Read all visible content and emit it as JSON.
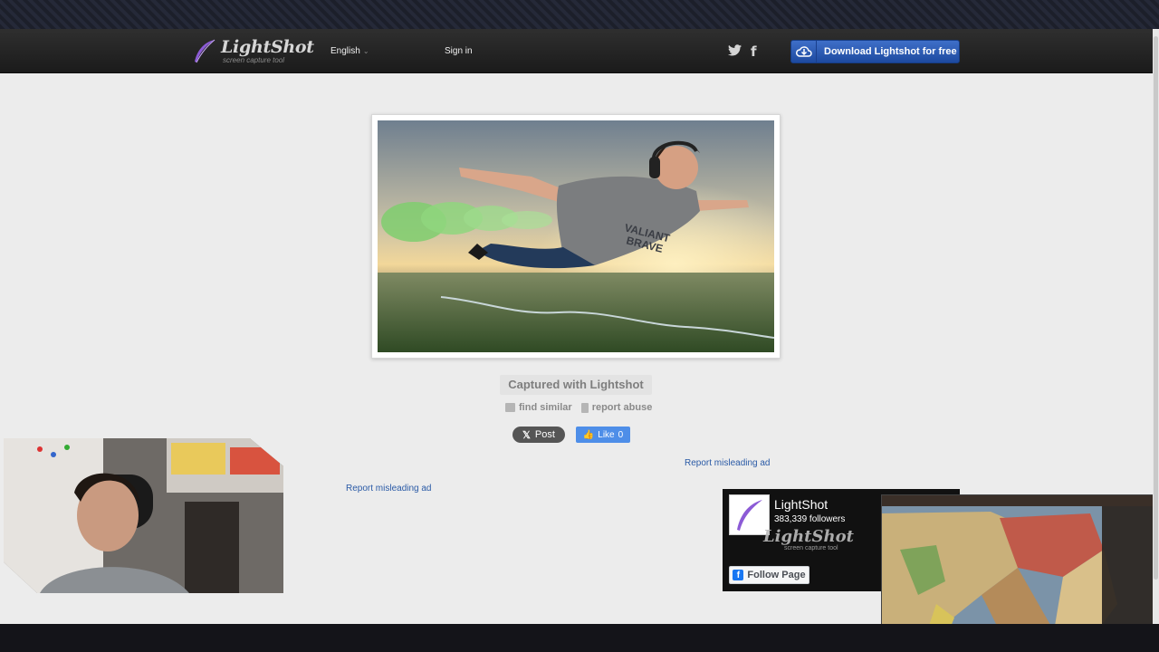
{
  "header": {
    "logo_name": "LightShot",
    "logo_tagline": "screen capture tool",
    "language": "English",
    "sign_in": "Sign in",
    "download_label": "Download Lightshot for free"
  },
  "main": {
    "captured_label": "Captured with Lightshot",
    "find_similar": "find similar",
    "report_abuse": "report abuse",
    "post_label": "Post",
    "like_label": "Like",
    "like_count": "0",
    "report_ad_1": "Report misleading ad",
    "report_ad_2": "Report misleading ad"
  },
  "fb_widget": {
    "page_name": "LightShot",
    "followers": "383,339 followers",
    "logo_mark": "LightShot",
    "logo_sub": "screen capture tool",
    "follow_label": "Follow Page"
  },
  "shot_text": {
    "shirt_line1": "VALIANT",
    "shirt_line2": "BRAVE"
  },
  "colors": {
    "accent": "#2a5aa6",
    "download_button": "#2f5fb8",
    "like_button": "#4e8ee8"
  }
}
